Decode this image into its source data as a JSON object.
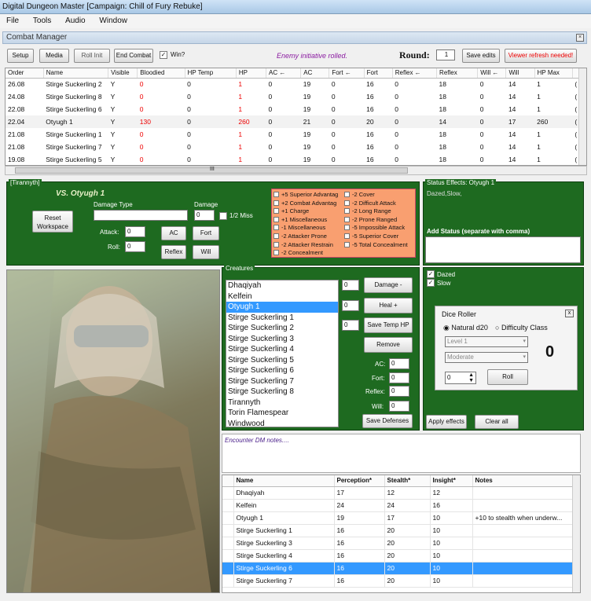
{
  "window": {
    "title": "Digital Dungeon Master [Campaign: Chill of Fury Rebuke]"
  },
  "menu": [
    "File",
    "Tools",
    "Audio",
    "Window"
  ],
  "combat_manager": {
    "title": "Combat Manager"
  },
  "toolbar": {
    "setup": "Setup",
    "media": "Media",
    "roll_init": "Roll Init",
    "end_combat": "End Combat",
    "win_label": "Win?",
    "win_checked": "✓",
    "status": "Enemy initiative rolled.",
    "round_label": "Round:",
    "round_value": "1",
    "save_edits": "Save edits",
    "refresh": "Viewer refresh needed!"
  },
  "initiative_table": {
    "columns": [
      "Order",
      "Name",
      "Visible",
      "Bloodied",
      "HP Temp",
      "HP",
      "AC ←",
      "AC",
      "Fort ←",
      "Fort",
      "Reflex ←",
      "Reflex",
      "Will ←",
      "Will",
      "HP Max",
      ""
    ],
    "rows": [
      [
        "26.08",
        "Stirge Suckerling 2",
        "Y",
        "0",
        "0",
        "1",
        "0",
        "19",
        "0",
        "16",
        "0",
        "18",
        "0",
        "14",
        "1",
        "("
      ],
      [
        "24.08",
        "Stirge Suckerling 8",
        "Y",
        "0",
        "0",
        "1",
        "0",
        "19",
        "0",
        "16",
        "0",
        "18",
        "0",
        "14",
        "1",
        "("
      ],
      [
        "22.08",
        "Stirge Suckerling 6",
        "Y",
        "0",
        "0",
        "1",
        "0",
        "19",
        "0",
        "16",
        "0",
        "18",
        "0",
        "14",
        "1",
        "("
      ],
      [
        "22.04",
        "Otyugh 1",
        "Y",
        "130",
        "0",
        "260",
        "0",
        "21",
        "0",
        "20",
        "0",
        "14",
        "0",
        "17",
        "260",
        "("
      ],
      [
        "21.08",
        "Stirge Suckerling 1",
        "Y",
        "0",
        "0",
        "1",
        "0",
        "19",
        "0",
        "16",
        "0",
        "18",
        "0",
        "14",
        "1",
        "("
      ],
      [
        "21.08",
        "Stirge Suckerling 7",
        "Y",
        "0",
        "0",
        "1",
        "0",
        "19",
        "0",
        "16",
        "0",
        "18",
        "0",
        "14",
        "1",
        "("
      ],
      [
        "19.08",
        "Stirge Suckerling 5",
        "Y",
        "0",
        "0",
        "1",
        "0",
        "19",
        "0",
        "16",
        "0",
        "18",
        "0",
        "14",
        "1",
        "("
      ]
    ],
    "scroll_marker": "III"
  },
  "attack_panel": {
    "title": "[Tirannyth]",
    "vs": "VS. Otyugh 1",
    "reset": "Reset Workspace",
    "damage_type_label": "Damage Type",
    "damage_label": "Damage",
    "damage_value": "0",
    "half_miss": "1/2 Miss",
    "attack_label": "Attack:",
    "attack_value": "0",
    "roll_label": "Roll:",
    "roll_value": "0",
    "ac": "AC",
    "fort": "Fort",
    "reflex": "Reflex",
    "will": "Will",
    "conditions_left": [
      "+5 Superior Advantag",
      "+2 Combat Advantag",
      "+1 Charge",
      "+1 Miscellaneous",
      "-1 Miscellaneous",
      "-2 Attacker Prone",
      "-2 Attacker Restrain",
      "-2 Concealment"
    ],
    "conditions_right": [
      "-2 Cover",
      "-2 Difficult Attack",
      "-2 Long Range",
      "-2 Prone Ranged",
      "-5 Impossible Attack",
      "-5 Superior Cover",
      "-5 Total Concealment"
    ]
  },
  "status_panel": {
    "title": "Status Effects: Otyugh 1",
    "current": "Dazed,Slow,",
    "add_label": "Add Status (separate with comma)"
  },
  "creatures_panel": {
    "title": "Creatures",
    "items": [
      "Dhaqiyah",
      "Kelfein",
      "Otyugh 1",
      "Stirge Suckerling 1",
      "Stirge Suckerling 2",
      "Stirge Suckerling 3",
      "Stirge Suckerling 4",
      "Stirge Suckerling 5",
      "Stirge Suckerling 6",
      "Stirge Suckerling 7",
      "Stirge Suckerling 8",
      "Tirannyth",
      "Torin Flamespear",
      "Windwood"
    ],
    "selected": "Otyugh 1",
    "damage_value": "0",
    "heal_value": "0",
    "temp_value": "0",
    "damage_btn": "Damage -",
    "heal_btn": "Heal +",
    "temp_btn": "Save Temp HP",
    "remove_btn": "Remove",
    "ac_label": "AC:",
    "ac_value": "0",
    "fort_label": "Fort:",
    "fort_value": "0",
    "reflex_label": "Reflex:",
    "reflex_value": "0",
    "will_label": "Will:",
    "will_value": "0",
    "save_defenses": "Save Defenses"
  },
  "effects_panel": {
    "effects": [
      "Dazed",
      "Slow"
    ],
    "check_mark": "✓",
    "apply": "Apply effects",
    "clear": "Clear all"
  },
  "dice_roller": {
    "title": "Dice Roller",
    "close": "x",
    "natural": "Natural d20",
    "difficulty": "Difficulty Class",
    "level": "Level 1",
    "moderate": "Moderate",
    "result": "0",
    "count": "0",
    "roll": "Roll"
  },
  "notes": {
    "placeholder": "Encounter DM notes...."
  },
  "skills_table": {
    "columns": [
      "",
      "Name",
      "Perception*",
      "Stealth*",
      "Insight*",
      "Notes"
    ],
    "rows": [
      [
        "",
        "Dhaqiyah",
        "17",
        "12",
        "12",
        ""
      ],
      [
        "",
        "Kelfein",
        "24",
        "24",
        "16",
        ""
      ],
      [
        "",
        "Otyugh 1",
        "19",
        "17",
        "10",
        "+10 to stealth when underw..."
      ],
      [
        "",
        "Stirge Suckerling 1",
        "16",
        "20",
        "10",
        ""
      ],
      [
        "",
        "Stirge Suckerling 3",
        "16",
        "20",
        "10",
        ""
      ],
      [
        "",
        "Stirge Suckerling 4",
        "16",
        "20",
        "10",
        ""
      ],
      [
        "",
        "Stirge Suckerling 6",
        "16",
        "20",
        "10",
        ""
      ],
      [
        "",
        "Stirge Suckerling 7",
        "16",
        "20",
        "10",
        ""
      ]
    ],
    "selected_index": 6
  },
  "colors": {
    "panel_green": "#1e6a20",
    "condition_orange": "#f99f70",
    "selection_blue": "#3399ff",
    "red_value": "#ee0000"
  }
}
